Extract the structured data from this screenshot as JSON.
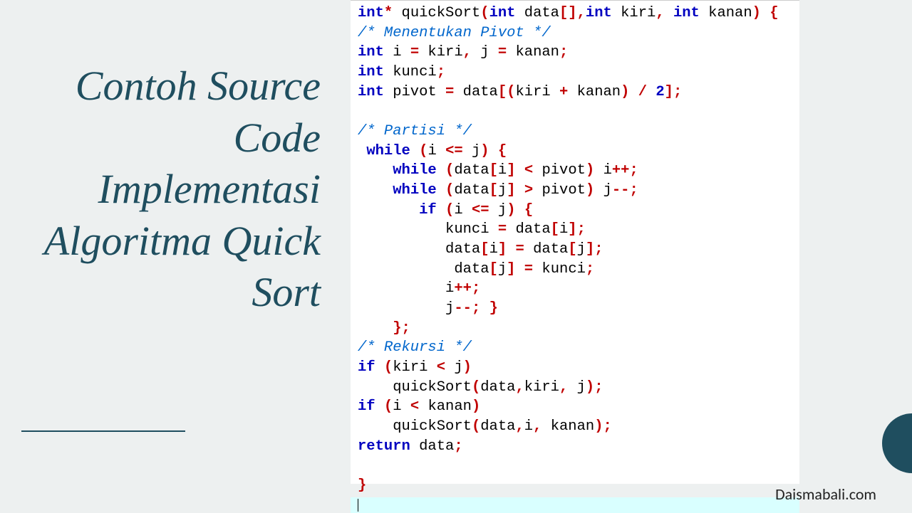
{
  "title": "Contoh Source Code Implementasi Algoritma Quick Sort",
  "watermark": "Daismabali.com",
  "code": {
    "lines": [
      {
        "indent": 0,
        "tokens": [
          [
            "kw",
            "int"
          ],
          [
            "op",
            "*"
          ],
          [
            "txt",
            " quickSort"
          ],
          [
            "op",
            "("
          ],
          [
            "kw",
            "int"
          ],
          [
            "txt",
            " data"
          ],
          [
            "op",
            "[],"
          ],
          [
            "kw",
            "int"
          ],
          [
            "txt",
            " kiri"
          ],
          [
            "op",
            ","
          ],
          [
            "txt",
            " "
          ],
          [
            "kw",
            "int"
          ],
          [
            "txt",
            " kanan"
          ],
          [
            "op",
            ")"
          ],
          [
            "txt",
            " "
          ],
          [
            "op",
            "{"
          ]
        ]
      },
      {
        "indent": 0,
        "tokens": [
          [
            "cm",
            "/* Menentukan Pivot */"
          ]
        ]
      },
      {
        "indent": 0,
        "tokens": [
          [
            "kw",
            "int"
          ],
          [
            "txt",
            " i "
          ],
          [
            "op",
            "="
          ],
          [
            "txt",
            " kiri"
          ],
          [
            "op",
            ","
          ],
          [
            "txt",
            " j "
          ],
          [
            "op",
            "="
          ],
          [
            "txt",
            " kanan"
          ],
          [
            "op",
            ";"
          ]
        ]
      },
      {
        "indent": 0,
        "tokens": [
          [
            "kw",
            "int"
          ],
          [
            "txt",
            " kunci"
          ],
          [
            "op",
            ";"
          ]
        ]
      },
      {
        "indent": 0,
        "tokens": [
          [
            "kw",
            "int"
          ],
          [
            "txt",
            " pivot "
          ],
          [
            "op",
            "="
          ],
          [
            "txt",
            " data"
          ],
          [
            "op",
            "[("
          ],
          [
            "txt",
            "kiri "
          ],
          [
            "op",
            "+"
          ],
          [
            "txt",
            " kanan"
          ],
          [
            "op",
            ")"
          ],
          [
            "txt",
            " "
          ],
          [
            "op",
            "/"
          ],
          [
            "txt",
            " "
          ],
          [
            "kw",
            "2"
          ],
          [
            "op",
            "];"
          ]
        ]
      },
      {
        "indent": 0,
        "tokens": []
      },
      {
        "indent": 0,
        "tokens": [
          [
            "cm",
            "/* Partisi */"
          ]
        ]
      },
      {
        "indent": 1,
        "tokens": [
          [
            "kw",
            "while"
          ],
          [
            "txt",
            " "
          ],
          [
            "op",
            "("
          ],
          [
            "txt",
            "i "
          ],
          [
            "op",
            "<="
          ],
          [
            "txt",
            " j"
          ],
          [
            "op",
            ")"
          ],
          [
            "txt",
            " "
          ],
          [
            "op",
            "{"
          ]
        ]
      },
      {
        "indent": 4,
        "tokens": [
          [
            "kw",
            "while"
          ],
          [
            "txt",
            " "
          ],
          [
            "op",
            "("
          ],
          [
            "txt",
            "data"
          ],
          [
            "op",
            "["
          ],
          [
            "txt",
            "i"
          ],
          [
            "op",
            "]"
          ],
          [
            "txt",
            " "
          ],
          [
            "op",
            "<"
          ],
          [
            "txt",
            " pivot"
          ],
          [
            "op",
            ")"
          ],
          [
            "txt",
            " i"
          ],
          [
            "op",
            "++;"
          ]
        ]
      },
      {
        "indent": 4,
        "tokens": [
          [
            "kw",
            "while"
          ],
          [
            "txt",
            " "
          ],
          [
            "op",
            "("
          ],
          [
            "txt",
            "data"
          ],
          [
            "op",
            "["
          ],
          [
            "txt",
            "j"
          ],
          [
            "op",
            "]"
          ],
          [
            "txt",
            " "
          ],
          [
            "op",
            ">"
          ],
          [
            "txt",
            " pivot"
          ],
          [
            "op",
            ")"
          ],
          [
            "txt",
            " j"
          ],
          [
            "op",
            "--;"
          ]
        ]
      },
      {
        "indent": 7,
        "tokens": [
          [
            "kw",
            "if"
          ],
          [
            "txt",
            " "
          ],
          [
            "op",
            "("
          ],
          [
            "txt",
            "i "
          ],
          [
            "op",
            "<="
          ],
          [
            "txt",
            " j"
          ],
          [
            "op",
            ")"
          ],
          [
            "txt",
            " "
          ],
          [
            "op",
            "{"
          ]
        ]
      },
      {
        "indent": 10,
        "tokens": [
          [
            "txt",
            "kunci "
          ],
          [
            "op",
            "="
          ],
          [
            "txt",
            " data"
          ],
          [
            "op",
            "["
          ],
          [
            "txt",
            "i"
          ],
          [
            "op",
            "];"
          ]
        ]
      },
      {
        "indent": 10,
        "tokens": [
          [
            "txt",
            "data"
          ],
          [
            "op",
            "["
          ],
          [
            "txt",
            "i"
          ],
          [
            "op",
            "]"
          ],
          [
            "txt",
            " "
          ],
          [
            "op",
            "="
          ],
          [
            "txt",
            " data"
          ],
          [
            "op",
            "["
          ],
          [
            "txt",
            "j"
          ],
          [
            "op",
            "];"
          ]
        ]
      },
      {
        "indent": 11,
        "tokens": [
          [
            "txt",
            "data"
          ],
          [
            "op",
            "["
          ],
          [
            "txt",
            "j"
          ],
          [
            "op",
            "]"
          ],
          [
            "txt",
            " "
          ],
          [
            "op",
            "="
          ],
          [
            "txt",
            " kunci"
          ],
          [
            "op",
            ";"
          ]
        ]
      },
      {
        "indent": 10,
        "tokens": [
          [
            "txt",
            "i"
          ],
          [
            "op",
            "++;"
          ]
        ]
      },
      {
        "indent": 10,
        "tokens": [
          [
            "txt",
            "j"
          ],
          [
            "op",
            "--;"
          ],
          [
            "txt",
            " "
          ],
          [
            "op",
            "}"
          ]
        ]
      },
      {
        "indent": 4,
        "tokens": [
          [
            "op",
            "};"
          ]
        ]
      },
      {
        "indent": 0,
        "tokens": [
          [
            "cm",
            "/* Rekursi */"
          ]
        ]
      },
      {
        "indent": 0,
        "tokens": [
          [
            "kw",
            "if"
          ],
          [
            "txt",
            " "
          ],
          [
            "op",
            "("
          ],
          [
            "txt",
            "kiri "
          ],
          [
            "op",
            "<"
          ],
          [
            "txt",
            " j"
          ],
          [
            "op",
            ")"
          ]
        ]
      },
      {
        "indent": 4,
        "tokens": [
          [
            "txt",
            "quickSort"
          ],
          [
            "op",
            "("
          ],
          [
            "txt",
            "data"
          ],
          [
            "op",
            ","
          ],
          [
            "txt",
            "kiri"
          ],
          [
            "op",
            ","
          ],
          [
            "txt",
            " j"
          ],
          [
            "op",
            ");"
          ]
        ]
      },
      {
        "indent": 0,
        "tokens": [
          [
            "kw",
            "if"
          ],
          [
            "txt",
            " "
          ],
          [
            "op",
            "("
          ],
          [
            "txt",
            "i "
          ],
          [
            "op",
            "<"
          ],
          [
            "txt",
            " kanan"
          ],
          [
            "op",
            ")"
          ]
        ]
      },
      {
        "indent": 4,
        "tokens": [
          [
            "txt",
            "quickSort"
          ],
          [
            "op",
            "("
          ],
          [
            "txt",
            "data"
          ],
          [
            "op",
            ","
          ],
          [
            "txt",
            "i"
          ],
          [
            "op",
            ","
          ],
          [
            "txt",
            " kanan"
          ],
          [
            "op",
            ");"
          ]
        ]
      },
      {
        "indent": 0,
        "tokens": [
          [
            "kw",
            "return"
          ],
          [
            "txt",
            " data"
          ],
          [
            "op",
            ";"
          ]
        ]
      },
      {
        "indent": 0,
        "tokens": []
      },
      {
        "indent": 0,
        "tokens": [
          [
            "op",
            "}"
          ]
        ]
      }
    ]
  }
}
